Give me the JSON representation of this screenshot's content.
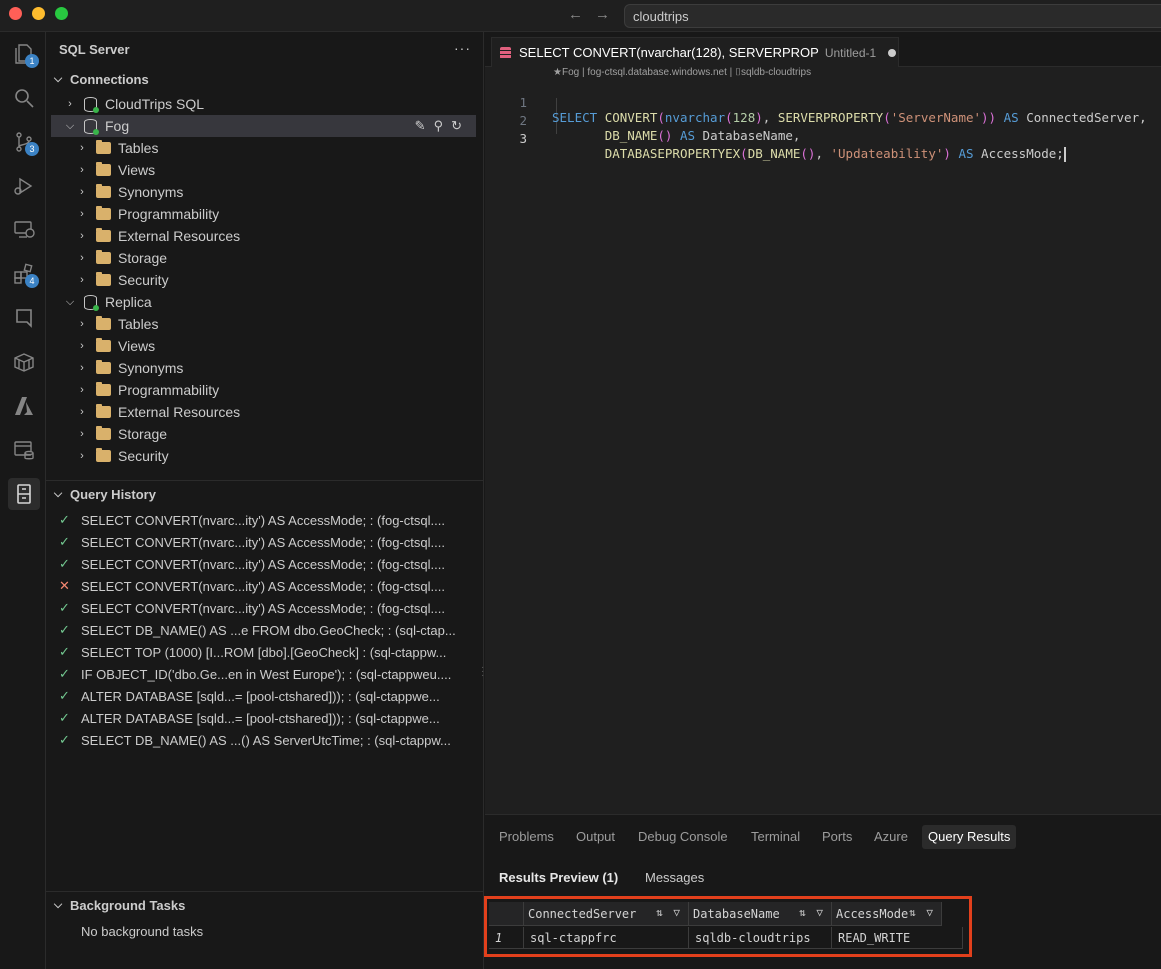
{
  "titlebar": {
    "search_text": "cloudtrips"
  },
  "activity": {
    "explorer_badge": "1",
    "scm_badge": "3",
    "extensions_badge": "4"
  },
  "sidebar": {
    "title": "SQL Server",
    "more": "···",
    "connections_header": "Connections",
    "connections": [
      {
        "label": "CloudTrips SQL"
      },
      {
        "label": "Fog",
        "children": [
          "Tables",
          "Views",
          "Synonyms",
          "Programmability",
          "External Resources",
          "Storage",
          "Security"
        ]
      },
      {
        "label": "Replica",
        "children": [
          "Tables",
          "Views",
          "Synonyms",
          "Programmability",
          "External Resources",
          "Storage",
          "Security"
        ]
      }
    ],
    "history_header": "Query History",
    "history": [
      {
        "status": "ok",
        "text": "SELECT CONVERT(nvarc...ity') AS AccessMode; : (fog-ctsql...."
      },
      {
        "status": "ok",
        "text": "SELECT CONVERT(nvarc...ity') AS AccessMode; : (fog-ctsql...."
      },
      {
        "status": "ok",
        "text": "SELECT CONVERT(nvarc...ity') AS AccessMode; : (fog-ctsql...."
      },
      {
        "status": "err",
        "text": "SELECT CONVERT(nvarc...ity') AS AccessMode; : (fog-ctsql...."
      },
      {
        "status": "ok",
        "text": "SELECT CONVERT(nvarc...ity') AS AccessMode; : (fog-ctsql...."
      },
      {
        "status": "ok",
        "text": "SELECT DB_NAME() AS ...e FROM dbo.GeoCheck; : (sql-ctap..."
      },
      {
        "status": "ok",
        "text": "SELECT TOP (1000) [I...ROM [dbo].[GeoCheck] : (sql-ctappw..."
      },
      {
        "status": "ok",
        "text": "IF OBJECT_ID('dbo.Ge...en in West Europe'); : (sql-ctappweu...."
      },
      {
        "status": "ok",
        "text": "ALTER DATABASE [sqld...= [pool-ctshared])); : (sql-ctappwe..."
      },
      {
        "status": "ok",
        "text": "ALTER DATABASE [sqld...= [pool-ctshared])); : (sql-ctappwe..."
      },
      {
        "status": "ok",
        "text": "SELECT DB_NAME() AS ...() AS ServerUtcTime; : (sql-ctappw..."
      }
    ],
    "background_header": "Background Tasks",
    "background_empty": "No background tasks"
  },
  "editor": {
    "tab_title": "SELECT CONVERT(nvarchar(128), SERVERPROP",
    "tab_desc": "Untitled-1",
    "breadcrumb": "★Fog | fog-ctsql.database.windows.net | ⌷sqldb-cloudtrips",
    "line_numbers": [
      "1",
      "2",
      "3"
    ]
  },
  "panel": {
    "tabs": [
      "Problems",
      "Output",
      "Debug Console",
      "Terminal",
      "Ports",
      "Azure",
      "Query Results"
    ],
    "active_tab": "Query Results",
    "subtabs": [
      "Results Preview (1)",
      "Messages"
    ],
    "results": {
      "columns": [
        "ConnectedServer",
        "DatabaseName",
        "AccessMode"
      ],
      "rows": [
        {
          "index": "1",
          "cells": [
            "sql-ctappfrc",
            "sqldb-cloudtrips",
            "READ_WRITE"
          ]
        }
      ]
    }
  },
  "colors": {
    "accent_highlight": "#e2401c",
    "ok": "#73c991",
    "error": "#f48771"
  }
}
